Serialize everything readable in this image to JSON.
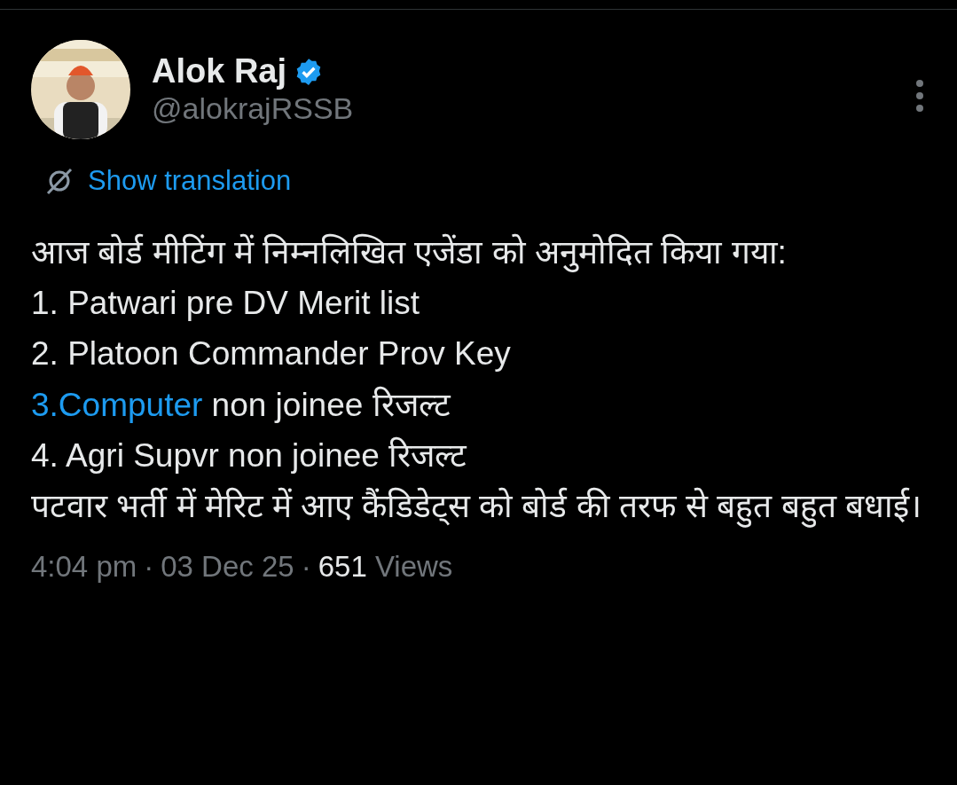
{
  "author": {
    "name": "Alok Raj",
    "verified": true,
    "handle": "@alokrajRSSB"
  },
  "translation_link": "Show translation",
  "body": [
    {
      "segments": [
        {
          "kind": "text",
          "text": "आज बोर्ड मीटिंग में निम्नलिखित एजेंडा को अनुमोदित किया गया:"
        }
      ]
    },
    {
      "segments": [
        {
          "kind": "text",
          "text": "1. Patwari pre DV Merit list"
        }
      ]
    },
    {
      "segments": [
        {
          "kind": "text",
          "text": "2. Platoon Commander Prov Key"
        }
      ]
    },
    {
      "segments": [
        {
          "kind": "link",
          "text": "3.Computer"
        },
        {
          "kind": "text",
          "text": " non joinee रिजल्ट"
        }
      ]
    },
    {
      "segments": [
        {
          "kind": "text",
          "text": "4. Agri Supvr non joinee रिजल्ट"
        }
      ]
    },
    {
      "segments": [
        {
          "kind": "text",
          "text": "पटवार भर्ती में मेरिट में आए कैंडिडेट्स को बोर्ड की तरफ से बहुत बहुत बधाई।"
        }
      ]
    }
  ],
  "meta": {
    "time": "4:04 pm",
    "separator_1": "·",
    "date": "03 Dec 25",
    "separator_2": "·",
    "views_count": "651",
    "views_label": "Views"
  }
}
